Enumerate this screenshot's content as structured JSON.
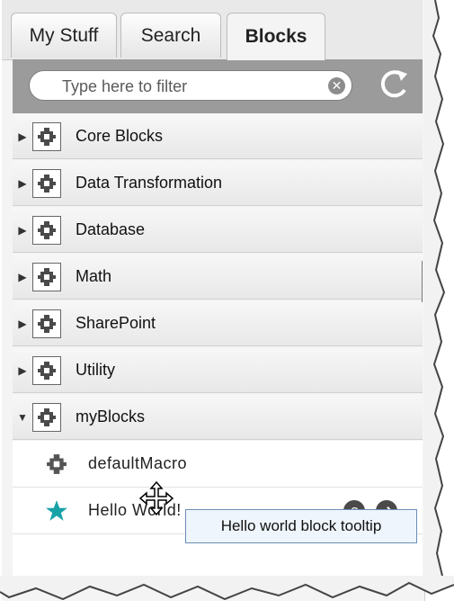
{
  "tabs": [
    {
      "label": "My Stuff",
      "active": false
    },
    {
      "label": "Search",
      "active": false
    },
    {
      "label": "Blocks",
      "active": true
    }
  ],
  "filter": {
    "placeholder": "Type here to filter"
  },
  "categories": [
    {
      "label": "Core Blocks",
      "expanded": false
    },
    {
      "label": "Data Transformation",
      "expanded": false
    },
    {
      "label": "Database",
      "expanded": false
    },
    {
      "label": "Math",
      "expanded": false
    },
    {
      "label": "SharePoint",
      "expanded": false
    },
    {
      "label": "Utility",
      "expanded": false
    },
    {
      "label": "myBlocks",
      "expanded": true
    }
  ],
  "items": [
    {
      "label": "defaultMacro",
      "icon": "gear-icon"
    },
    {
      "label": "Hello World!",
      "icon": "star-icon"
    }
  ],
  "tooltip": "Hello world block tooltip",
  "colors": {
    "star": "#17a2a8",
    "icon_dark": "#4a4a4a"
  }
}
